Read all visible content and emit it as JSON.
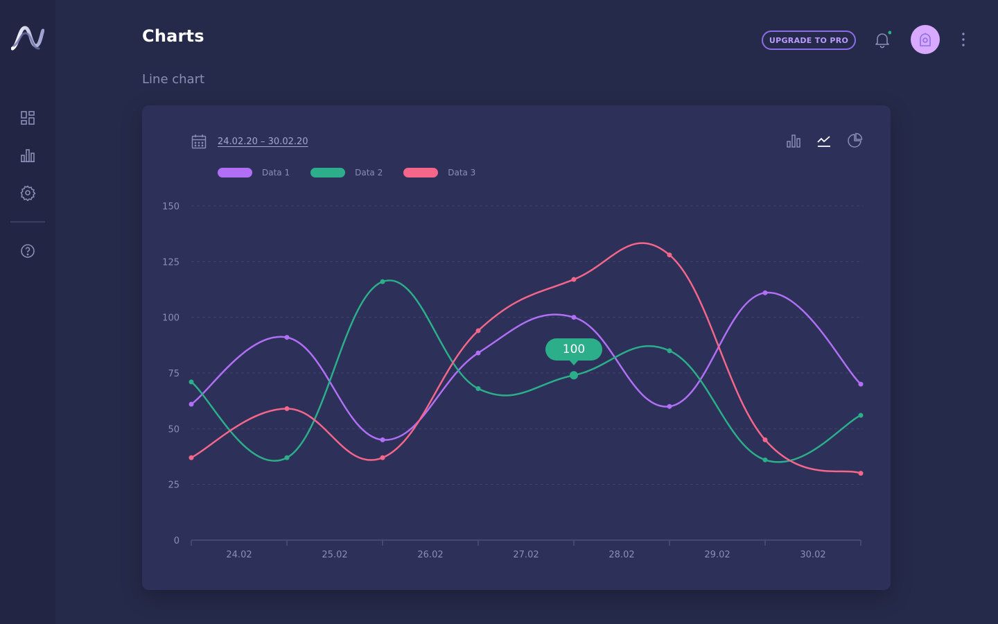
{
  "header": {
    "title": "Charts",
    "section": "Line chart",
    "upgrade_label": "UPGRADE TO PRO"
  },
  "sidebar": {
    "items": [
      {
        "icon": "dashboard-icon"
      },
      {
        "icon": "bar-chart-icon"
      },
      {
        "icon": "settings-icon"
      },
      {
        "icon": "help-icon"
      }
    ]
  },
  "toolbar": {
    "date_range": "24.02.20 – 30.02.20",
    "chart_types": [
      "bar-chart-icon",
      "line-chart-icon",
      "pie-chart-icon"
    ],
    "active_type": "line-chart-icon"
  },
  "colors": {
    "background": "#262a4a",
    "card": "#2d3159",
    "accent": "#8b6ee6",
    "notification_dot": "#2cae8a"
  },
  "tooltip": {
    "value": "100",
    "series": "Data 2",
    "category": "27.02"
  },
  "chart_data": {
    "type": "line",
    "categories": [
      "24.02",
      "25.02",
      "26.02",
      "27.02",
      "28.02",
      "29.02",
      "30.02"
    ],
    "x": [
      0,
      1,
      2,
      3,
      4,
      5,
      6,
      7
    ],
    "ylim": [
      0,
      150
    ],
    "yticks": [
      0,
      25,
      50,
      75,
      100,
      125,
      150
    ],
    "grid": true,
    "legend": "top-left",
    "series": [
      {
        "name": "Data 1",
        "color": "#b06ff5",
        "values": [
          61,
          91,
          45,
          84,
          100,
          60,
          111,
          70
        ]
      },
      {
        "name": "Data 2",
        "color": "#2cae8a",
        "values": [
          71,
          37,
          116,
          68,
          74,
          85,
          36,
          56
        ]
      },
      {
        "name": "Data 3",
        "color": "#f4668a",
        "values": [
          37,
          59,
          37,
          94,
          117,
          128,
          45,
          30
        ]
      }
    ],
    "highlight": {
      "series": 1,
      "index": 4
    }
  }
}
